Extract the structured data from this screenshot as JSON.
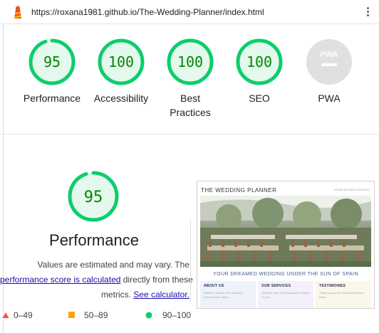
{
  "url_bar": {
    "url": "https://roxana1981.github.io/The-Wedding-Planner/index.html"
  },
  "summary": {
    "categories": [
      {
        "score": "95",
        "label": "Performance",
        "fraction": 0.95,
        "color": "#0cce6b",
        "status": "pass"
      },
      {
        "score": "100",
        "label": "Accessibility",
        "fraction": 1.0,
        "color": "#0cce6b",
        "status": "pass"
      },
      {
        "score": "100",
        "label": "Best Practices",
        "fraction": 1.0,
        "color": "#0cce6b",
        "status": "pass"
      },
      {
        "score": "100",
        "label": "SEO",
        "fraction": 1.0,
        "color": "#0cce6b",
        "status": "pass"
      },
      {
        "score": "PWA",
        "label": "PWA",
        "fraction": 0,
        "color": "#e0e0e0",
        "status": "na"
      }
    ]
  },
  "performance": {
    "score": "95",
    "fraction": 0.95,
    "title": "Performance",
    "desc_1": "Values are estimated and may vary. The",
    "desc_link_1": "performance score is calculated",
    "desc_2": " directly from these",
    "desc_3": "metrics. ",
    "desc_link_2": "See calculator."
  },
  "legend": {
    "fail": "0–49",
    "average": "50–89",
    "pass": "90–100",
    "colors": {
      "fail": "#ff4e42",
      "average": "#ffa400",
      "pass": "#0cce6b"
    }
  },
  "thumbnail": {
    "brand": "THE WEDDING PLANNER",
    "nav": "HOME   DETAILS   CONTACT",
    "tagline": "YOUR DREAMED WEDDING UNDER THE SUN OF SPAIN",
    "col1_title": "ABOUT US",
    "col1_text": "Based in Madrid, The Wedding Planner team offers ...",
    "col2_title": "OUR SERVICES",
    "col2_text": "We take care of every detail in relation to your ...",
    "col3_title": "TESTIMONIES",
    "col3_text": "Thank you to The Wedding Planner team ..."
  }
}
